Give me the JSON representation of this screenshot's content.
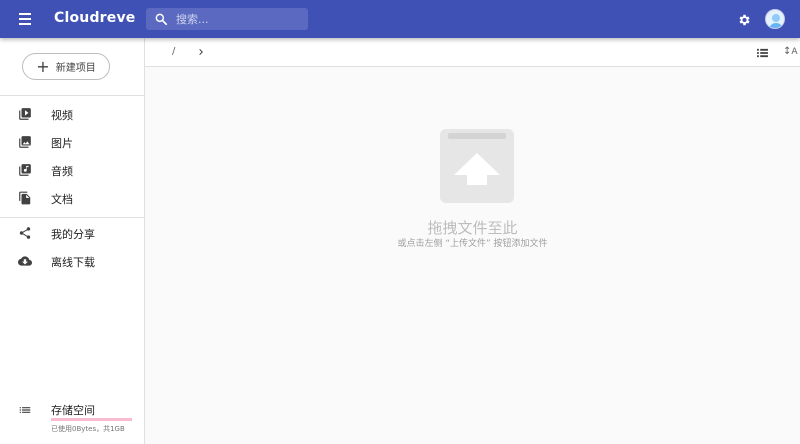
{
  "app": {
    "title": "Cloudreve",
    "brand_color": "#3f51b5"
  },
  "search": {
    "placeholder": "搜索..."
  },
  "sidebar": {
    "new_button_label": "新建项目",
    "items": [
      {
        "label": "视频",
        "icon": "video-library-icon"
      },
      {
        "label": "图片",
        "icon": "photo-library-icon"
      },
      {
        "label": "音频",
        "icon": "music-library-icon"
      },
      {
        "label": "文档",
        "icon": "file-copy-icon"
      },
      {
        "label": "我的分享",
        "icon": "share-icon"
      },
      {
        "label": "离线下载",
        "icon": "cloud-download-icon"
      }
    ],
    "storage": {
      "title": "存储空间",
      "info": "已使用0Bytes，共1GB",
      "used_fraction": 0.0
    }
  },
  "navigator": {
    "root": "/",
    "sort_label": "A"
  },
  "empty_state": {
    "title": "拖拽文件至此",
    "subtitle": "或点击左侧 “上传文件” 按钮添加文件"
  }
}
